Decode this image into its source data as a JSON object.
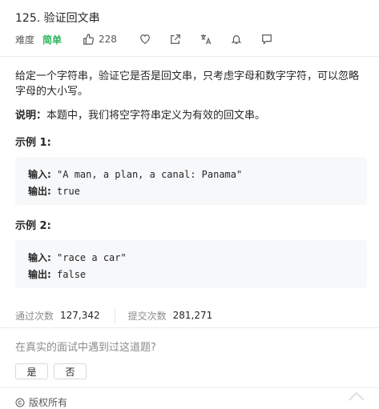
{
  "problem": {
    "title": "125. 验证回文串"
  },
  "meta": {
    "difficulty_label": "难度",
    "difficulty_value": "简单",
    "likes": "228"
  },
  "description": {
    "p1": "给定一个字符串，验证它是否是回文串，只考虑字母和数字字符，可以忽略字母的大小写。",
    "note_label": "说明：",
    "note_text": "本题中，我们将空字符串定义为有效的回文串。"
  },
  "examples": [
    {
      "heading": "示例 1:",
      "input_label": "输入:",
      "input": " \"A man, a plan, a canal: Panama\"",
      "output_label": "输出:",
      "output": " true"
    },
    {
      "heading": "示例 2:",
      "input_label": "输入:",
      "input": " \"race a car\"",
      "output_label": "输出:",
      "output": " false"
    }
  ],
  "stats": {
    "accepted_label": "通过次数",
    "accepted_value": "127,342",
    "submissions_label": "提交次数",
    "submissions_value": "281,271"
  },
  "interview": {
    "question": "在真实的面试中遇到过这道题?",
    "yes": "是",
    "no": "否"
  },
  "footer": {
    "copyright": "版权所有"
  },
  "colors": {
    "easy": "#2db55d",
    "muted": "#8c8c8c",
    "code_bg": "#f7f8fa"
  },
  "icons": [
    "thumbs-up-icon",
    "heart-icon",
    "share-icon",
    "translate-icon",
    "bell-icon",
    "comment-icon"
  ]
}
